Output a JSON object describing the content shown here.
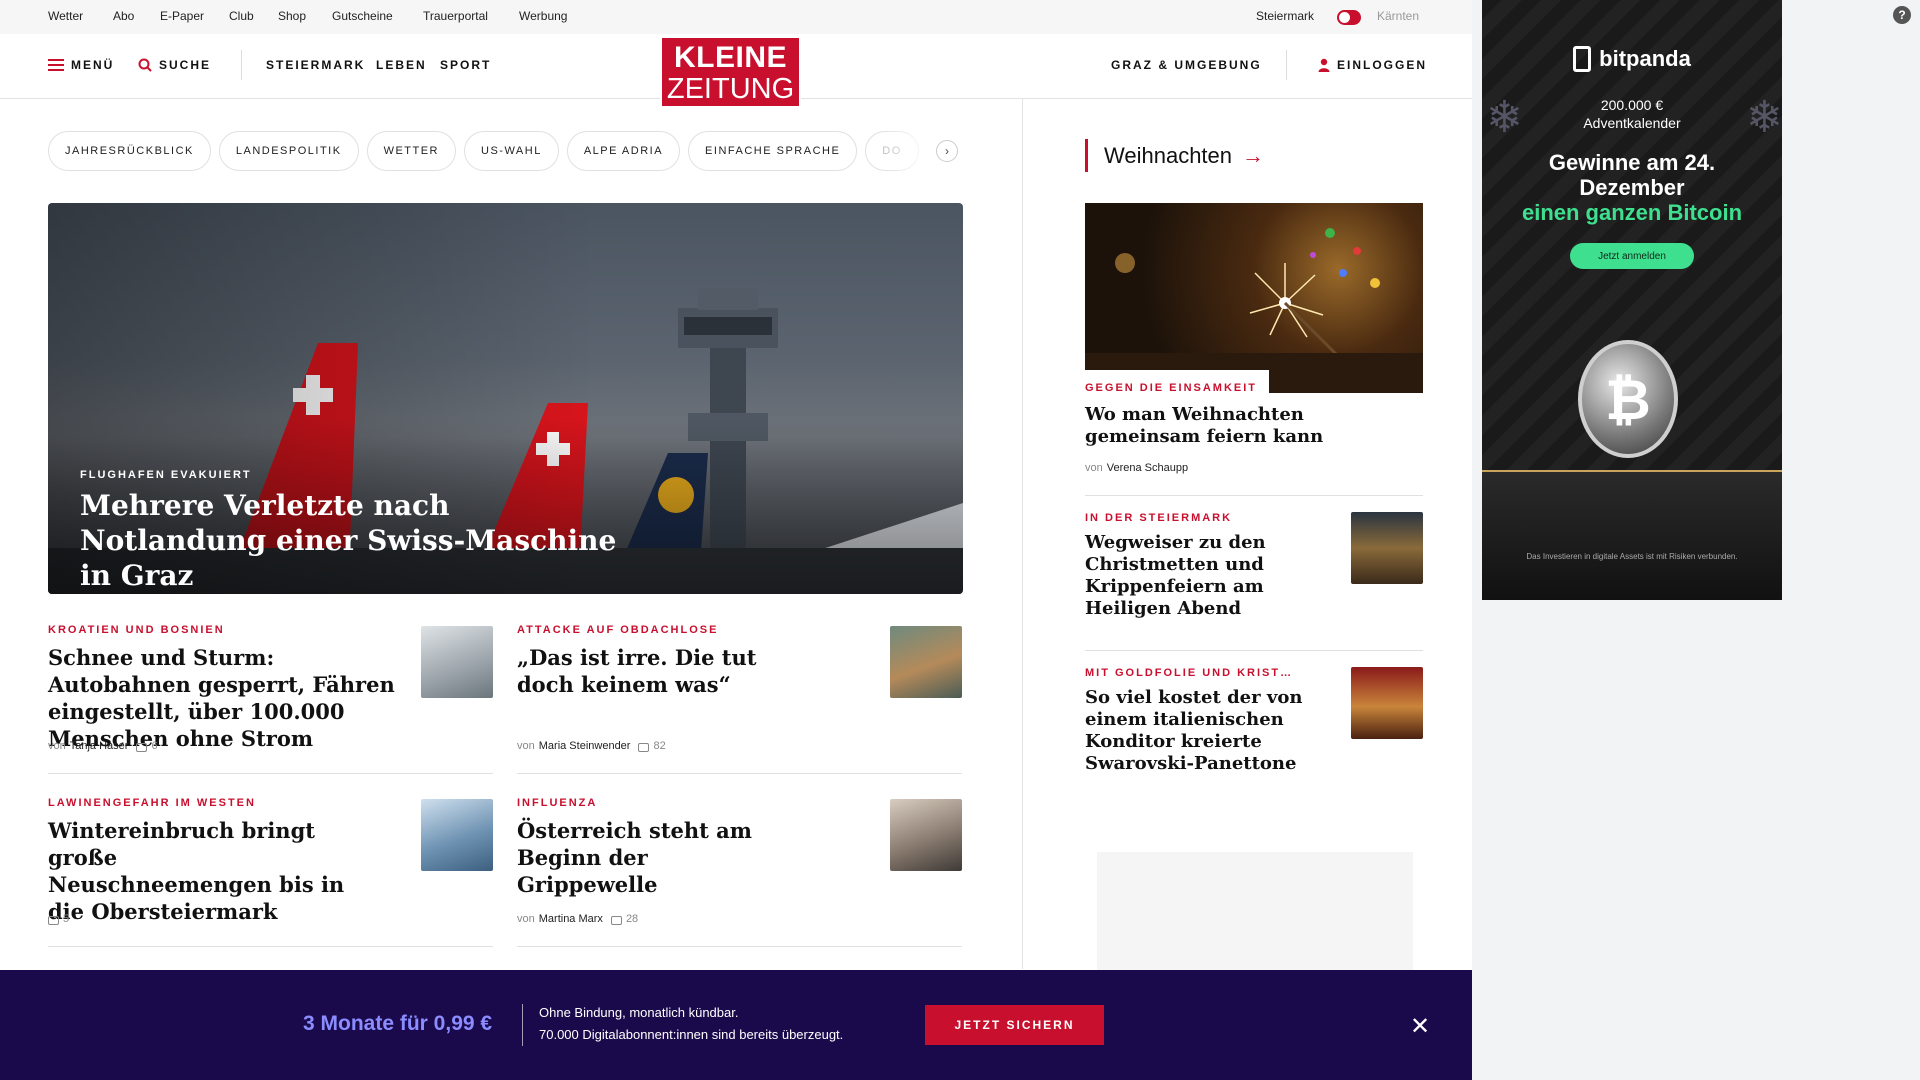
{
  "util": {
    "links": [
      "Wetter",
      "Abo",
      "E-Paper",
      "Club",
      "Shop",
      "Gutscheine",
      "Trauerportal",
      "Werbung"
    ],
    "region_left": "Steiermark",
    "region_right": "Kärnten"
  },
  "header": {
    "menu": "MENÜ",
    "search": "SUCHE",
    "nav": [
      "STEIERMARK",
      "LEBEN",
      "SPORT"
    ],
    "logo_line1": "KLEINE",
    "logo_line2": "ZEITUNG",
    "location": "GRAZ & UMGEBUNG",
    "login": "EINLOGGEN"
  },
  "tags": [
    "JAHRESRÜCKBLICK",
    "LANDESPOLITIK",
    "WETTER",
    "US-WAHL",
    "ALPE ADRIA",
    "EINFACHE SPRACHE",
    "DO"
  ],
  "hero": {
    "kicker": "FLUGHAFEN EVAKUIERT",
    "title": "Mehrere Verletzte nach Notlandung einer Swiss-Maschine in Graz"
  },
  "articles": [
    {
      "kicker": "KROATIEN UND BOSNIEN",
      "title": "Schnee und Sturm: Autobahnen gesperrt, Fähren eingestellt, über 100.000 Menschen ohne Strom",
      "by": "von",
      "author": "Tanja Haser",
      "comments": "6"
    },
    {
      "kicker": "ATTACKE AUF OBDACHLOSE",
      "title": "„Das ist irre. Die tut doch keinem was“",
      "by": "von",
      "author": "Maria Steinwender",
      "comments": "82"
    },
    {
      "kicker": "LAWINENGEFAHR IM WESTEN",
      "title": "Wintereinbruch bringt große Neuschneemengen bis in die Obersteiermark",
      "comments": "5"
    },
    {
      "kicker": "INFLUENZA",
      "title": "Österreich steht am Beginn der Grippewelle",
      "by": "von",
      "author": "Martina Marx",
      "comments": "28"
    }
  ],
  "sidebar": {
    "heading": "Weihnachten",
    "items": [
      {
        "kicker": "GEGEN DIE EINSAMKEIT",
        "title": "Wo man Weihnachten gemeinsam feiern kann",
        "by": "von",
        "author": "Verena Schaupp"
      },
      {
        "kicker": "IN DER STEIERMARK",
        "title": "Wegweiser zu den Christmetten und Krippenfeiern am Heiligen Abend"
      },
      {
        "kicker": "MIT GOLDFOLIE UND KRIST…",
        "title": "So viel kostet der von einem italienischen Konditor kreierte Swarovski-Panettone"
      }
    ]
  },
  "ad": {
    "brand": "bitpanda",
    "sub1": "200.000 €",
    "sub2": "Adventkalender",
    "line1": "Gewinne am 24.",
    "line2": "Dezember",
    "line3": "einen ganzen Bitcoin",
    "cta": "Jetzt anmelden",
    "disclaimer": "Das Investieren in digitale Assets ist mit Risiken verbunden."
  },
  "paywall": {
    "price": "3 Monate für 0,99 €",
    "line1": "Ohne Bindung, monatlich kündbar.",
    "line2": "70.000 Digitalabonnent:innen sind bereits überzeugt.",
    "cta": "JETZT SICHERN"
  },
  "colors": {
    "brand_red": "#c8102e",
    "paywall_bg": "#1b0a4b",
    "paywall_price": "#8a8cff",
    "ad_accent": "#3ee08f"
  }
}
